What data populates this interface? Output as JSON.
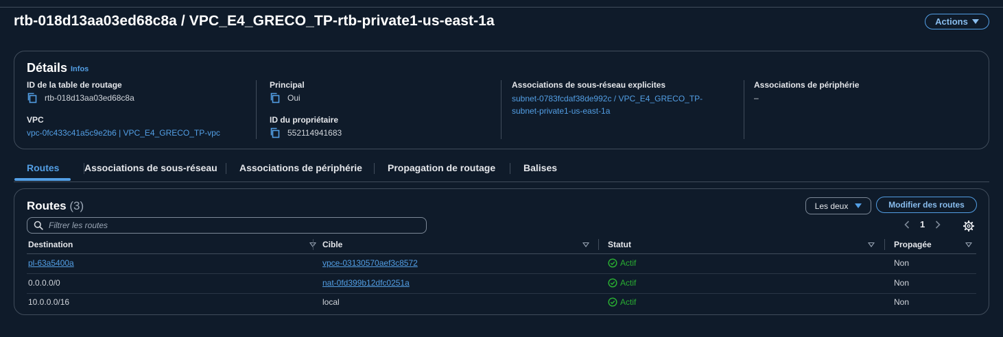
{
  "page": {
    "title": "rtb-018d13aa03ed68c8a / VPC_E4_GRECO_TP-rtb-private1-us-east-1a",
    "actions_label": "Actions"
  },
  "details": {
    "heading": "Détails",
    "info_link": "Infos",
    "route_table_id_label": "ID de la table de routage",
    "route_table_id": "rtb-018d13aa03ed68c8a",
    "vpc_label": "VPC",
    "vpc_value": "vpc-0fc433c41a5c9e2b6 | VPC_E4_GRECO_TP-vpc",
    "main_label": "Principal",
    "main_value": "Oui",
    "owner_label": "ID du propriétaire",
    "owner_value": "552114941683",
    "subnet_assoc_label": "Associations de sous-réseau explicites",
    "subnet_assoc_line1": "subnet-0783fcdaf38de992c / VPC_E4_GRECO_TP-",
    "subnet_assoc_line2": "subnet-private1-us-east-1a",
    "edge_assoc_label": "Associations de périphérie",
    "edge_assoc_value": "–"
  },
  "tabs": [
    {
      "label": "Routes",
      "active": true
    },
    {
      "label": "Associations de sous-réseau",
      "active": false
    },
    {
      "label": "Associations de périphérie",
      "active": false
    },
    {
      "label": "Propagation de routage",
      "active": false
    },
    {
      "label": "Balises",
      "active": false
    }
  ],
  "routes": {
    "heading": "Routes",
    "count": "(3)",
    "filter_select": "Les deux",
    "modify_label": "Modifier des routes",
    "search_placeholder": "Filtrer les routes",
    "current_page": "1",
    "columns": [
      "Destination",
      "Cible",
      "Statut",
      "Propagée"
    ],
    "rows": [
      {
        "destination": "pl-63a5400a",
        "target": "vpce-03130570aef3c8572",
        "status": "Actif",
        "propagated": "Non"
      },
      {
        "destination": "0.0.0.0/0",
        "target": "nat-0fd399b12dfc0251a",
        "status": "Actif",
        "propagated": "Non"
      },
      {
        "destination": "10.0.0.0/16",
        "target": "local",
        "status": "Actif",
        "propagated": "Non"
      }
    ]
  },
  "colors": {
    "background": "#0f1b2a",
    "link": "#539fe5",
    "success": "#29ad32",
    "border": "#414d5c"
  }
}
